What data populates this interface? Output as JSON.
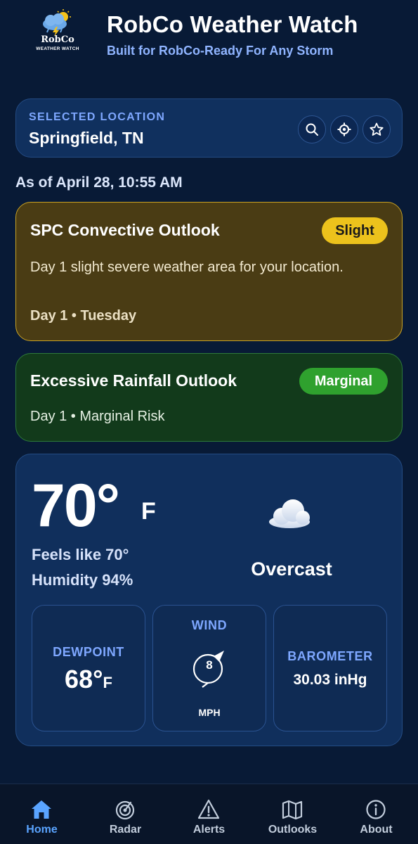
{
  "header": {
    "logo_text": "RobCo",
    "logo_sub": "WEATHER WATCH",
    "title": "RobCo Weather Watch",
    "subtitle": "Built for RobCo-Ready For Any Storm"
  },
  "location": {
    "label": "SELECTED LOCATION",
    "name": "Springfield, TN",
    "buttons": [
      "search-icon",
      "locate-icon",
      "star-icon"
    ]
  },
  "as_of": "As of April 28, 10:55 AM",
  "spc": {
    "title": "SPC Convective Outlook",
    "badge": "Slight",
    "description": "Day 1 slight severe weather area for your location.",
    "day": "Day 1 • Tuesday",
    "colors": {
      "bg": "#4a3c14",
      "border": "#c9a224",
      "badge": "#ecc21c"
    }
  },
  "rainfall": {
    "title": "Excessive Rainfall Outlook",
    "badge": "Marginal",
    "day": "Day 1 • Marginal Risk",
    "colors": {
      "bg": "#123a1b",
      "border": "#2e7a3a",
      "badge": "#2fa12e"
    }
  },
  "weather": {
    "temp": "70°",
    "unit": "F",
    "feels_like": "Feels like 70°",
    "humidity": "Humidity 94%",
    "condition": "Overcast",
    "condition_icon": "cloud-icon",
    "dewpoint": {
      "label": "DEWPOINT",
      "value": "68°",
      "unit": "F"
    },
    "wind": {
      "label": "WIND",
      "speed": "8",
      "unit": "MPH"
    },
    "barometer": {
      "label": "BAROMETER",
      "value": "30.03 inHg"
    }
  },
  "nav": {
    "items": [
      {
        "label": "Home",
        "icon": "home-icon",
        "active": true
      },
      {
        "label": "Radar",
        "icon": "radar-icon",
        "active": false
      },
      {
        "label": "Alerts",
        "icon": "alert-icon",
        "active": false
      },
      {
        "label": "Outlooks",
        "icon": "map-icon",
        "active": false
      },
      {
        "label": "About",
        "icon": "info-icon",
        "active": false
      }
    ],
    "active_color": "#5aa4ff"
  }
}
